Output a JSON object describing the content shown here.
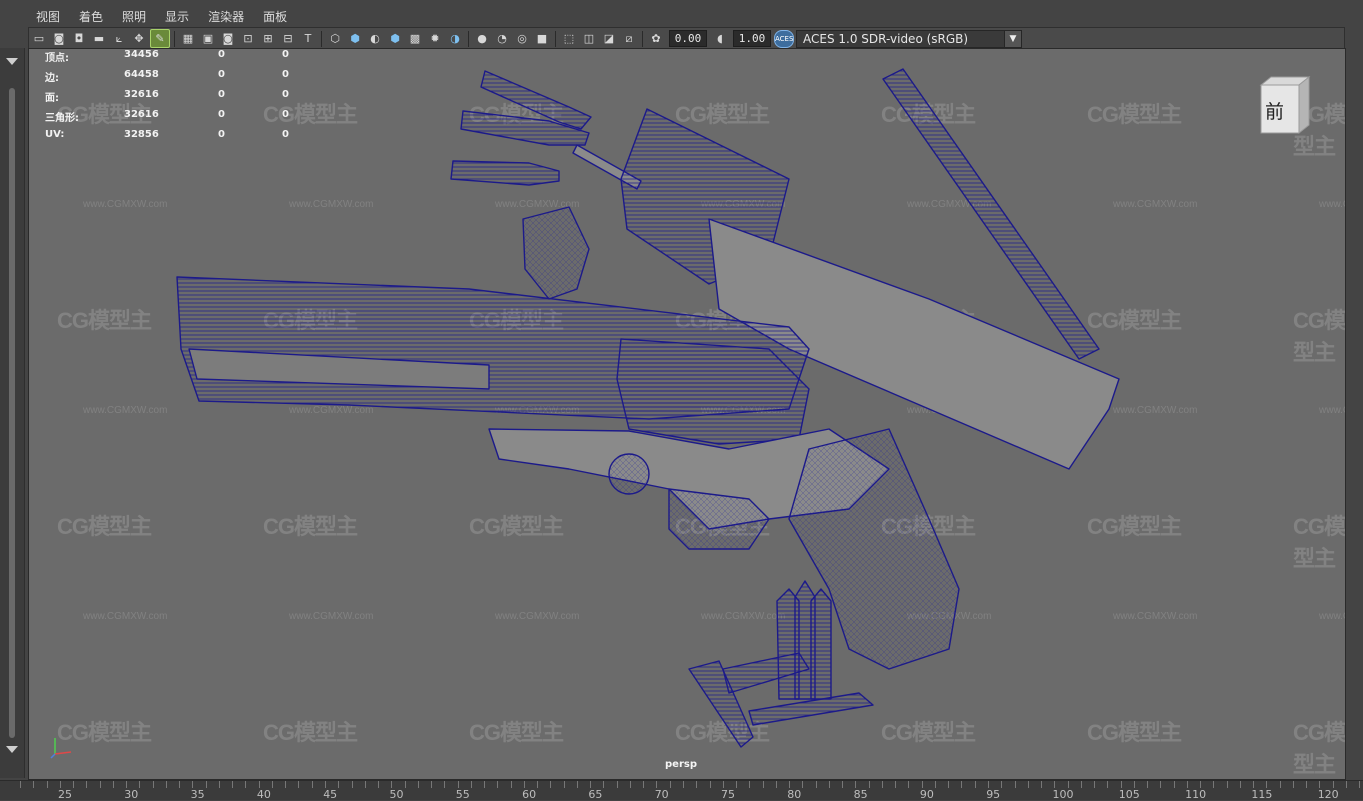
{
  "menus": [
    "视图",
    "着色",
    "照明",
    "显示",
    "渲染器",
    "面板"
  ],
  "toolbar": {
    "exposure_value": "0.00",
    "gamma_value": "1.00",
    "aces_icon_text": "ACES",
    "color_space": "ACES 1.0 SDR-video (sRGB)"
  },
  "hud": {
    "rows": [
      {
        "label": "顶点:",
        "value": "34456",
        "a": "0",
        "b": "0"
      },
      {
        "label": "边:",
        "value": "64458",
        "a": "0",
        "b": "0"
      },
      {
        "label": "面:",
        "value": "32616",
        "a": "0",
        "b": "0"
      },
      {
        "label": "三角形:",
        "value": "32616",
        "a": "0",
        "b": "0"
      },
      {
        "label": "UV:",
        "value": "32856",
        "a": "0",
        "b": "0"
      }
    ]
  },
  "viewcube_label": "前",
  "camera_label": "persp",
  "watermark_logo": "CG模型主",
  "watermark_url": "www.CGMXW.com",
  "ruler_labels": [
    "25",
    "30",
    "35",
    "40",
    "45",
    "50",
    "55",
    "60",
    "65",
    "70",
    "75",
    "80",
    "85",
    "90",
    "95",
    "100",
    "105",
    "110",
    "115",
    "120"
  ],
  "colors": {
    "viewport_bg": "#6b6b6b",
    "wireframe": "#1c1a8a",
    "toolbar_active": "#6a8a3a",
    "ui_bg": "#444444"
  }
}
